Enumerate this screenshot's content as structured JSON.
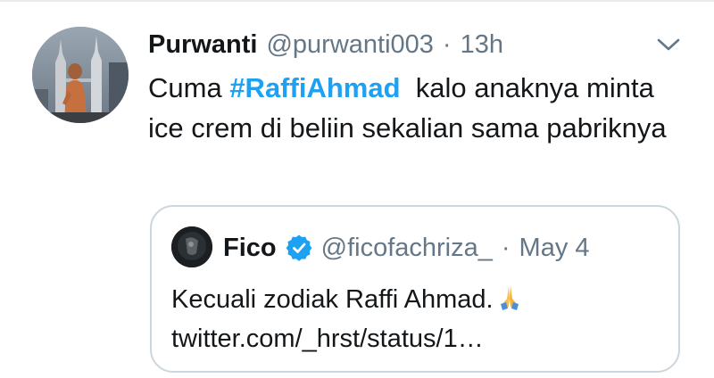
{
  "tweet": {
    "author_name": "Purwanti",
    "author_handle": "@purwanti003",
    "separator": "·",
    "timestamp": "13h",
    "text_before": "Cuma ",
    "hashtag": "#RaffiAhmad",
    "text_after": "  kalo anaknya minta ice crem di beliin sekalian sama pabriknya",
    "avatar_icon": "profile-photo-icon",
    "menu_icon": "chevron-down-icon"
  },
  "quote": {
    "author_name": "Fico",
    "author_handle": "@ficofachriza_",
    "separator": "·",
    "date": "May 4",
    "text": "Kecuali zodiak Raffi Ahmad.",
    "emoji_icon": "folded-hands-icon",
    "link": "twitter.com/_hrst/status/1…",
    "verified_icon": "verified-badge-icon"
  },
  "colors": {
    "link_blue": "#1da1f2",
    "secondary_text": "#657786",
    "border": "#ccd6dd",
    "primary_text": "#14171a"
  }
}
